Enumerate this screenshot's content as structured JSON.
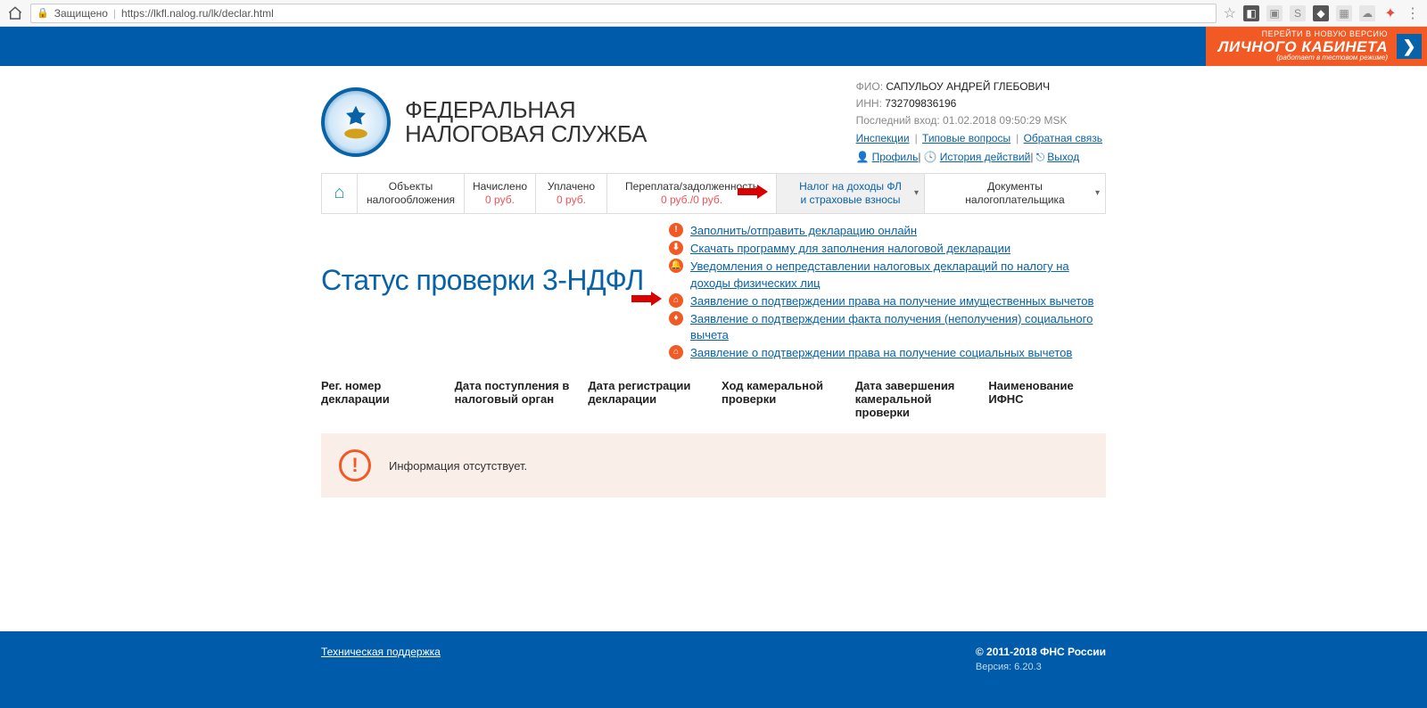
{
  "browser": {
    "secure_label": "Защищено",
    "url": "https://lkfl.nalog.ru/lk/declar.html"
  },
  "orange": {
    "line1": "ПЕРЕЙТИ В НОВУЮ ВЕРСИЮ",
    "line2": "ЛИЧНОГО КАБИНЕТА",
    "line3": "(работает в тестовом режиме)"
  },
  "logo": {
    "line1": "ФЕДЕРАЛЬНАЯ",
    "line2": "НАЛОГОВАЯ СЛУЖБА"
  },
  "user": {
    "fio_label": "ФИО:",
    "fio_value": "САПУЛЬОУ АНДРЕЙ ГЛЕБОВИЧ",
    "inn_label": "ИНН:",
    "inn_value": "732709836196",
    "last_login_label": "Последний вход:",
    "last_login_value": "01.02.2018 09:50:29 MSK",
    "links": {
      "inspections": "Инспекции",
      "faq": "Типовые вопросы",
      "feedback": "Обратная связь",
      "profile": "Профиль",
      "history": "История действий",
      "logout": "Выход"
    }
  },
  "tabs": {
    "objects": {
      "l1": "Объекты",
      "l2": "налогообложения"
    },
    "accrued": {
      "l1": "Начислено",
      "l2": "0 руб."
    },
    "paid": {
      "l1": "Уплачено",
      "l2": "0 руб."
    },
    "balance": {
      "l1": "Переплата/задолженность",
      "l2": "0 руб./0 руб."
    },
    "ndfl": {
      "l1": "Налог на доходы ФЛ",
      "l2": "и страховые взносы"
    },
    "docs": {
      "l1": "Документы",
      "l2": "налогоплательщика"
    }
  },
  "quick_links": [
    "Заполнить/отправить декларацию онлайн",
    "Скачать программу для заполнения налоговой декларации",
    "Уведомления о непредставлении налоговых деклараций по налогу на доходы физических лиц",
    "Заявление о подтверждении права на получение имущественных вычетов",
    "Заявление о подтверждении факта получения (неполучения) социального вычета",
    "Заявление о подтверждении права на получение социальных вычетов"
  ],
  "page_title": "Статус проверки 3-НДФЛ",
  "columns": {
    "c1": "Рег. номер декларации",
    "c2": "Дата поступления в налоговый орган",
    "c3": "Дата регистрации декларации",
    "c4": "Ход камеральной проверки",
    "c5": "Дата завершения камеральной проверки",
    "c6": "Наименование ИФНС"
  },
  "info_message": "Информация отсутствует.",
  "footer": {
    "support": "Техническая поддержка",
    "copyright": "© 2011-2018 ФНС России",
    "version": "Версия: 6.20.3"
  }
}
